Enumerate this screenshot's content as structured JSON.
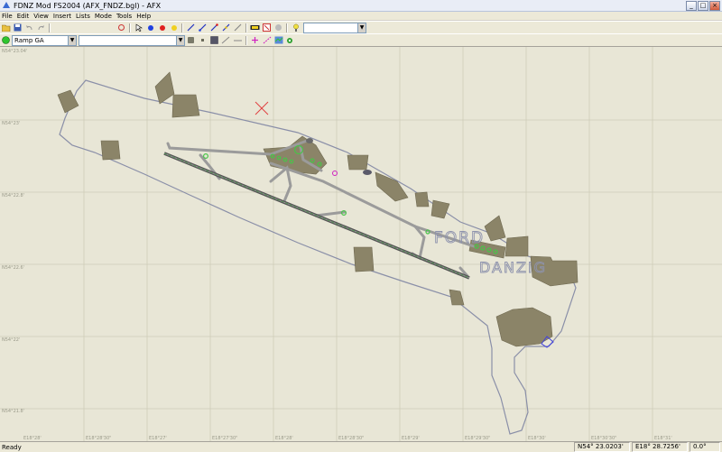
{
  "window": {
    "title": "FDNZ Mod FS2004 (AFX_FNDZ.bgl) - AFX",
    "buttons": [
      "_",
      "□",
      "×"
    ]
  },
  "menu": [
    "File",
    "Edit",
    "View",
    "Insert",
    "Lists",
    "Mode",
    "Tools",
    "Help"
  ],
  "toolbar2": {
    "object_type_value": "Ramp GA",
    "second_combo_value": ""
  },
  "map": {
    "labels": [
      "FORD",
      "DANZIG"
    ],
    "left_grid_labels": [
      "N54°23.04'",
      "N54°23'",
      "N54°22.8'",
      "N54°22.6'",
      "N54°22'",
      "N54°21.8'"
    ],
    "bottom_grid_labels": [
      "E18°28'",
      "E18°28'30\"",
      "E18°27'",
      "E18°27'30\"",
      "E18°28'",
      "E18°28'30\"",
      "E18°29'",
      "E18°29'30\"",
      "E18°30'",
      "E18°30'30\"",
      "E18°31'",
      "E18°31'30\""
    ],
    "colors": {
      "background": "#e8e6d6",
      "grid": "#cfcdb8",
      "boundary": "#8a8fa8",
      "apron": "#8b8468",
      "runway": "#555555",
      "taxi": "#9b9b9b",
      "light": "#49c449",
      "label": "#8e93ad"
    }
  },
  "status": {
    "ready": "Ready",
    "lat": "N54° 23.0203'",
    "lon": "E18° 28.7256'",
    "hdg": "0.0°"
  }
}
